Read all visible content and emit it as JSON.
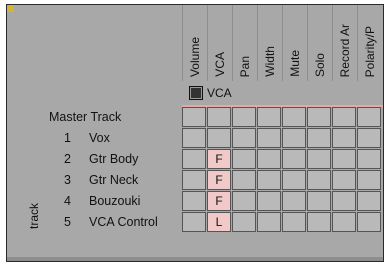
{
  "columns": [
    "Volume",
    "VCA",
    "Pan",
    "Width",
    "Mute",
    "Solo",
    "Record Ar",
    "Polarity/P"
  ],
  "group": {
    "name": "VCA"
  },
  "side_label": "track",
  "tracks": [
    {
      "number": "",
      "name": "Master Track",
      "cells": [
        "",
        "",
        "",
        "",
        "",
        "",
        "",
        ""
      ]
    },
    {
      "number": "1",
      "name": "Vox",
      "cells": [
        "",
        "",
        "",
        "",
        "",
        "",
        "",
        ""
      ]
    },
    {
      "number": "2",
      "name": "Gtr Body",
      "cells": [
        "",
        "F",
        "",
        "",
        "",
        "",
        "",
        ""
      ]
    },
    {
      "number": "3",
      "name": "Gtr Neck",
      "cells": [
        "",
        "F",
        "",
        "",
        "",
        "",
        "",
        ""
      ]
    },
    {
      "number": "4",
      "name": "Bouzouki",
      "cells": [
        "",
        "F",
        "",
        "",
        "",
        "",
        "",
        ""
      ]
    },
    {
      "number": "5",
      "name": "VCA Control",
      "cells": [
        "",
        "L",
        "",
        "",
        "",
        "",
        "",
        ""
      ]
    }
  ],
  "colors": {
    "panel": "#a8a8a8",
    "cell": "#b9b9b9",
    "flagged_cell": "#f2c9c9",
    "accent_line": "#e9a6a6",
    "corner_marker": "#d6b43a"
  }
}
